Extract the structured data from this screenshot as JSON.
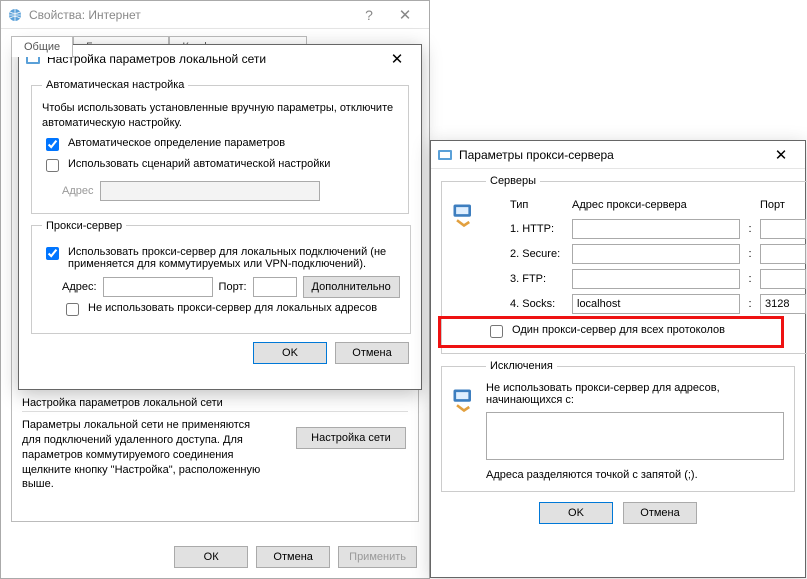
{
  "inet": {
    "title": "Свойства: Интернет",
    "tabs": [
      "Общие",
      "Безопасность",
      "Конфиденциальность"
    ],
    "lan_section_title": "Настройка параметров локальной сети",
    "lan_desc": "Параметры локальной сети не применяются для подключений удаленного доступа. Для параметров коммутируемого соединения щелкните кнопку \"Настройка\", расположенную выше.",
    "lan_button": "Настройка сети",
    "ok": "ОК",
    "cancel": "Отмена",
    "apply": "Применить"
  },
  "lan": {
    "title": "Настройка параметров локальной сети",
    "auto_group": "Автоматическая настройка",
    "auto_note": "Чтобы использовать установленные вручную параметры, отключите автоматическую настройку.",
    "auto_detect": "Автоматическое определение параметров",
    "auto_detect_checked": true,
    "use_script": "Использовать сценарий автоматической настройки",
    "use_script_checked": false,
    "address_label": "Адрес",
    "script_address": "",
    "proxy_group": "Прокси-сервер",
    "use_proxy": "Использовать прокси-сервер для локальных подключений (не применяется для коммутируемых или VPN-подключений).",
    "use_proxy_checked": true,
    "addr_label": "Адрес:",
    "addr_value": "",
    "port_label": "Порт:",
    "port_value": "",
    "advanced_btn": "Дополнительно",
    "bypass_local": "Не использовать прокси-сервер для локальных адресов",
    "bypass_local_checked": false,
    "ok": "OK",
    "cancel": "Отмена"
  },
  "adv": {
    "title": "Параметры прокси-сервера",
    "servers_group": "Серверы",
    "col_type": "Тип",
    "col_addr": "Адрес прокси-сервера",
    "col_port": "Порт",
    "rows": [
      {
        "label": "1. HTTP:",
        "addr": "",
        "port": ""
      },
      {
        "label": "2. Secure:",
        "addr": "",
        "port": ""
      },
      {
        "label": "3. FTP:",
        "addr": "",
        "port": ""
      },
      {
        "label": "4. Socks:",
        "addr": "localhost",
        "port": "3128"
      }
    ],
    "same_proxy": "Один прокси-сервер для всех протоколов",
    "same_proxy_checked": false,
    "excl_group": "Исключения",
    "excl_label": "Не использовать прокси-сервер для адресов, начинающихся с:",
    "excl_value": "",
    "excl_hint": "Адреса разделяются точкой с запятой (;).",
    "ok": "OK",
    "cancel": "Отмена"
  }
}
